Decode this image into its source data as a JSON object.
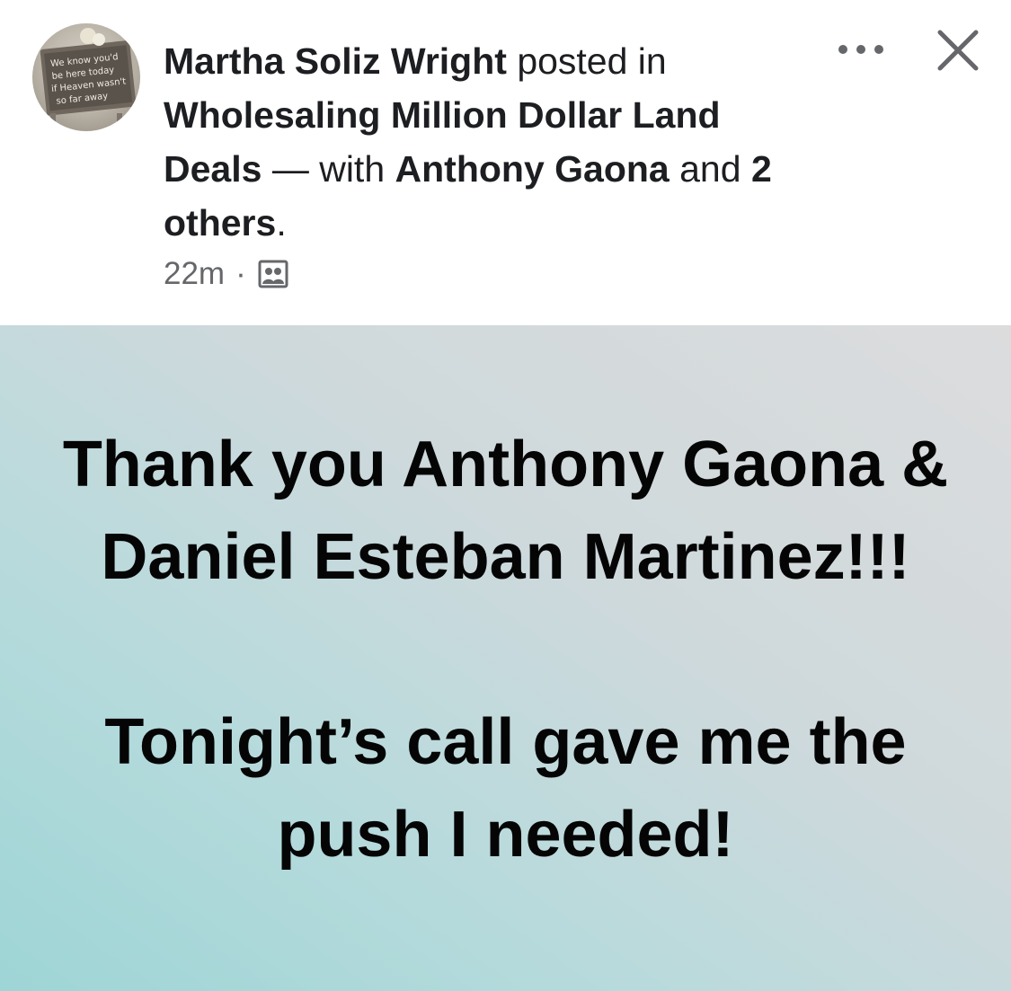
{
  "post": {
    "author": "Martha Soliz Wright",
    "posted_in_text": " posted in ",
    "group_name": "Wholesaling Million Dollar Land Deals",
    "with_text": " — with ",
    "tagged_person": "Anthony Gaona",
    "and_text": " and ",
    "others_text": "2 others",
    "period": ".",
    "timestamp": "22m",
    "separator": "·",
    "audience_icon": "group-icon",
    "more_icon": "more-options-icon",
    "close_icon": "close-icon",
    "avatar_text": [
      "We know you'd",
      "be here today",
      "if Heaven wasn't",
      "so far away"
    ]
  },
  "body": {
    "paragraph_1": "Thank you Anthony Gaona & Daniel Esteban Martinez!!!",
    "paragraph_2": "Tonight’s call gave me the push I needed!"
  },
  "colors": {
    "text_primary": "#1c1e21",
    "text_secondary": "#65676b",
    "background_gradient_start": "#9ed5d6",
    "background_gradient_end": "#dcdcdd"
  }
}
